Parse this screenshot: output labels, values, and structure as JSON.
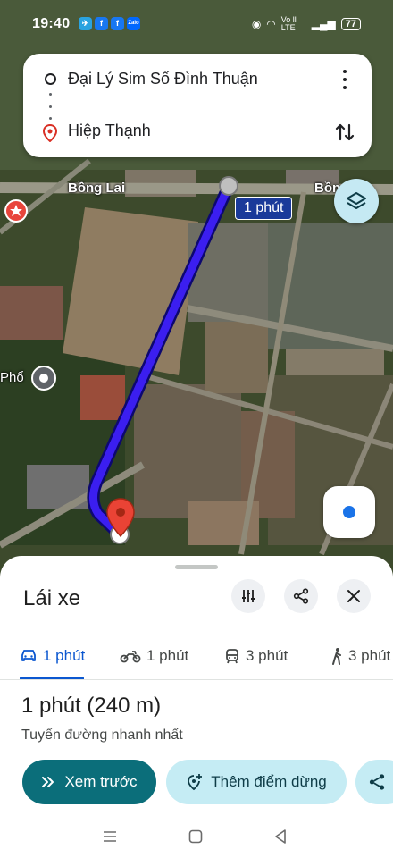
{
  "status_bar": {
    "time": "19:40",
    "network": "Vo ll LTE",
    "battery": "77"
  },
  "route": {
    "origin": "Đại Lý Sim Số Đình Thuận",
    "destination": "Hiệp Thạnh"
  },
  "map": {
    "road_label_left": "Bồng Lai",
    "road_label_right": "Bồn",
    "place_label": "Phổ",
    "eta_chip": "1 phút",
    "route_color": "#3b1ef0"
  },
  "sheet": {
    "mode_title": "Lái xe",
    "tabs": [
      {
        "icon": "car-icon",
        "label": "1 phút"
      },
      {
        "icon": "motorbike-icon",
        "label": "1 phút"
      },
      {
        "icon": "transit-icon",
        "label": "3 phút"
      },
      {
        "icon": "walk-icon",
        "label": "3 phút"
      }
    ],
    "summary": "1 phút (240 m)",
    "subtitle": "Tuyến đường nhanh nhất",
    "preview_label": "Xem trước",
    "add_stop_label": "Thêm điểm dừng"
  },
  "colors": {
    "accent": "#0b57d0",
    "primary_button": "#0b6e7a",
    "secondary_button": "#c5ecf4"
  }
}
